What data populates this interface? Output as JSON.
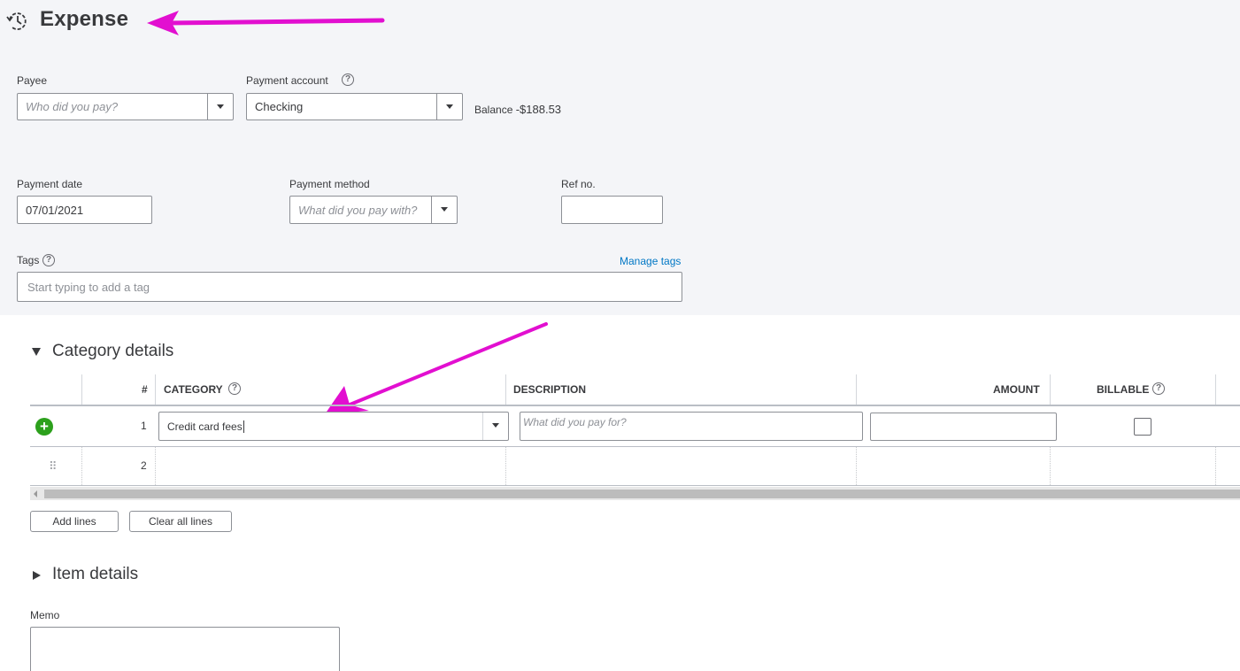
{
  "header": {
    "title": "Expense",
    "icon": "recurring-clock-icon"
  },
  "payee": {
    "label": "Payee",
    "placeholder": "Who did you pay?"
  },
  "payment_account": {
    "label": "Payment account",
    "value": "Checking",
    "balance_label": "Balance",
    "balance_value": "-$188.53"
  },
  "payment_date": {
    "label": "Payment date",
    "value": "07/01/2021"
  },
  "payment_method": {
    "label": "Payment method",
    "placeholder": "What did you pay with?"
  },
  "ref_no": {
    "label": "Ref no.",
    "value": ""
  },
  "tags": {
    "label": "Tags",
    "manage_link": "Manage tags",
    "placeholder": "Start typing to add a tag"
  },
  "category_details": {
    "title": "Category details",
    "columns": {
      "num": "#",
      "category": "CATEGORY",
      "description": "DESCRIPTION",
      "amount": "AMOUNT",
      "billable": "BILLABLE"
    },
    "rows": [
      {
        "num": "1",
        "category": "Credit card fees",
        "description_placeholder": "What did you pay for?",
        "amount": ""
      },
      {
        "num": "2",
        "category": "",
        "description_placeholder": "",
        "amount": ""
      }
    ],
    "add_lines": "Add lines",
    "clear_all_lines": "Clear all lines"
  },
  "item_details": {
    "title": "Item details"
  },
  "memo": {
    "label": "Memo",
    "value": ""
  },
  "help_glyph": "?",
  "plus_glyph": "+",
  "grip_glyph": "⠿",
  "colors": {
    "annotation_arrow": "#e20fd0",
    "accent_green": "#2ca01c",
    "link_blue": "#0077c5",
    "top_background": "#f4f5f8"
  }
}
